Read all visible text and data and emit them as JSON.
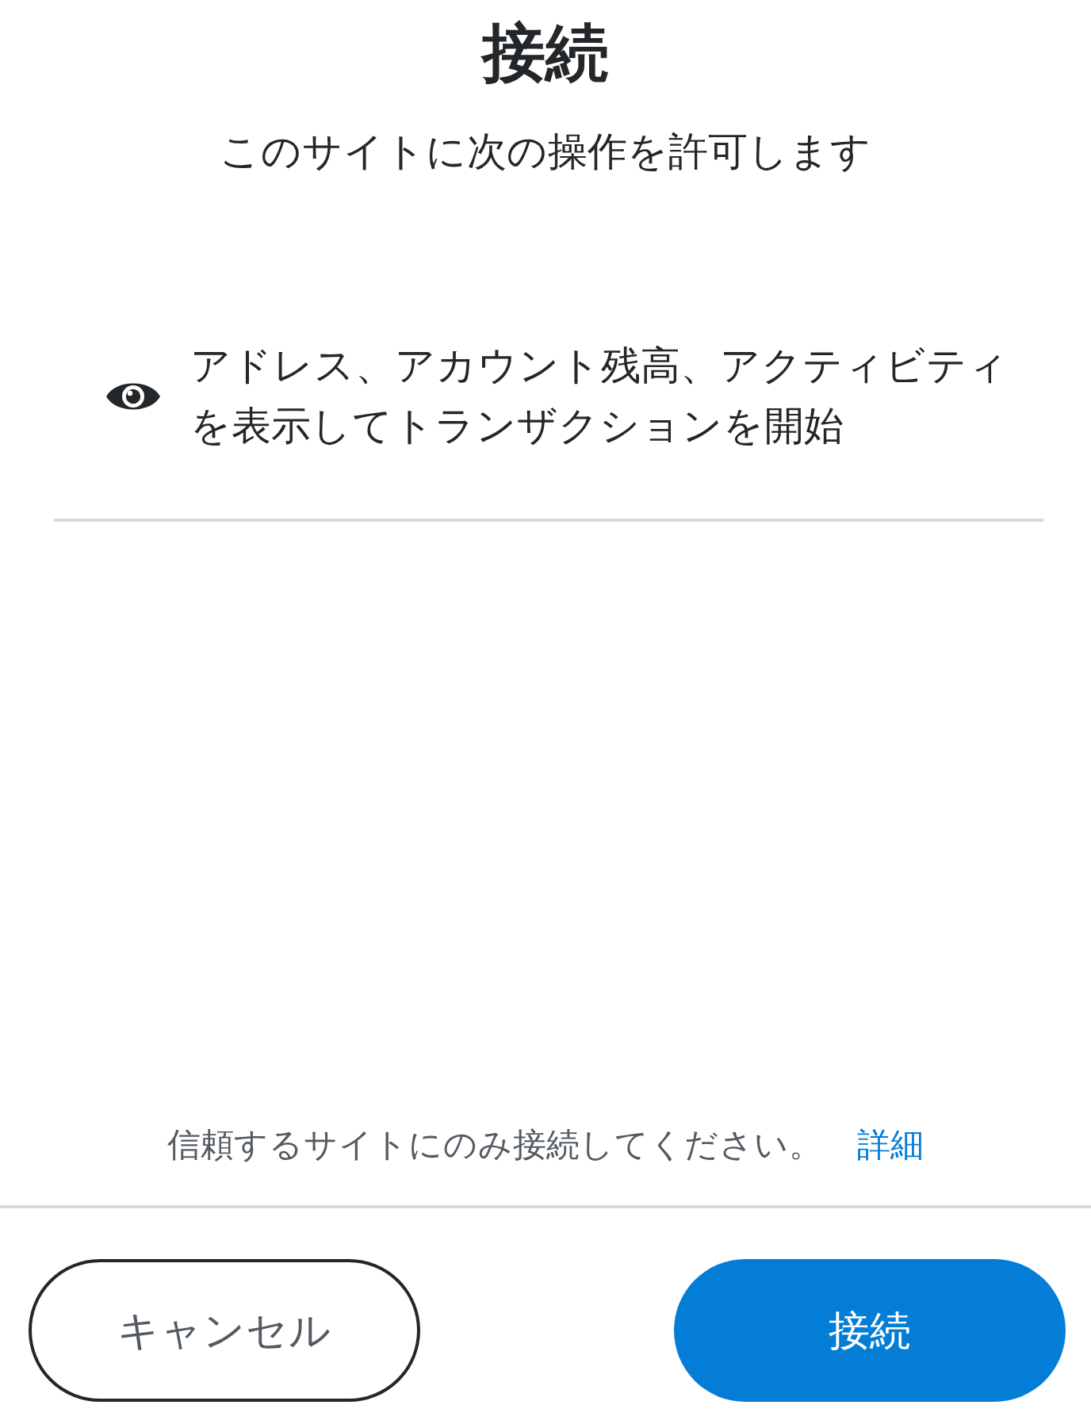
{
  "title": "接続",
  "subtitle": "このサイトに次の操作を許可します",
  "permissions": [
    {
      "kind": "view",
      "text": "アドレス、アカウント残高、アクティビティを表示してトランザクションを開始"
    }
  ],
  "notice": {
    "text": "信頼するサイトにのみ接続してください。",
    "link": "詳細"
  },
  "buttons": [
    {
      "kind": "secondary",
      "label": "キャンセル"
    },
    {
      "kind": "primary",
      "label": "接続"
    }
  ]
}
